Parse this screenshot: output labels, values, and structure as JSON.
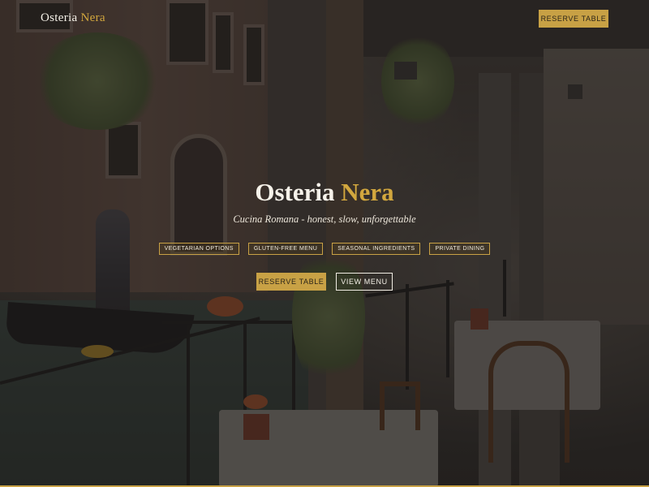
{
  "header": {
    "brand_first": "Osteria",
    "brand_second": "Nera",
    "reserve_label": "RESERVE TABLE"
  },
  "hero": {
    "title_first": "Osteria",
    "title_second": "Nera",
    "tagline": "Cucina Romana - honest, slow, unforgettable",
    "tags": [
      "VEGETARIAN OPTIONS",
      "GLUTEN-FREE MENU",
      "SEASONAL INGREDIENTS",
      "PRIVATE DINING"
    ],
    "reserve_label": "RESERVE TABLE",
    "menu_label": "VIEW MENU"
  },
  "colors": {
    "accent": "#c8a145",
    "text": "#f5f1e8"
  }
}
